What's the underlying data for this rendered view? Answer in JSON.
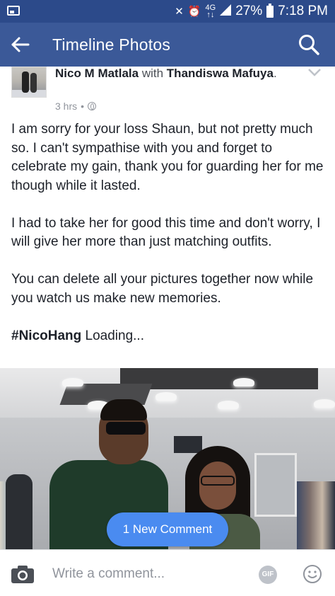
{
  "status_bar": {
    "network": "4G",
    "network_sub": "↑↓",
    "battery": "27%",
    "time": "7:18 PM",
    "icons": [
      "image-notification-icon",
      "mute-icon",
      "alarm-icon",
      "signal-icon",
      "battery-icon"
    ]
  },
  "app_bar": {
    "title": "Timeline Photos",
    "icons": [
      "back-arrow-icon",
      "search-icon"
    ]
  },
  "post": {
    "author": "Nico M Matlala",
    "with_word": "with",
    "tagged": "Thandiswa Mafuya",
    "period": ".",
    "time": "3 hrs",
    "separator": "•",
    "privacy_icon": "globe-icon",
    "paragraphs": [
      "I am sorry for your loss Shaun, but not pretty much so. I can't sympathise with you and forget to celebrate my gain, thank you for guarding her for me though while it lasted.",
      "I had to take her for good this time and don't worry, I will give her more than just matching outfits.",
      "You can delete all your pictures together now while you watch us make new memories."
    ],
    "hashtag": "#NicoHang",
    "hashtag_suffix": " Loading..."
  },
  "new_comment_pill": "1 New Comment",
  "composer": {
    "placeholder": "Write a comment...",
    "gif_label": "GIF",
    "icons": [
      "camera-icon",
      "gif-icon",
      "emoji-icon"
    ]
  },
  "colors": {
    "status_bar": "#2c4a8a",
    "app_bar": "#3b5998",
    "pill": "#4a8bf0"
  }
}
